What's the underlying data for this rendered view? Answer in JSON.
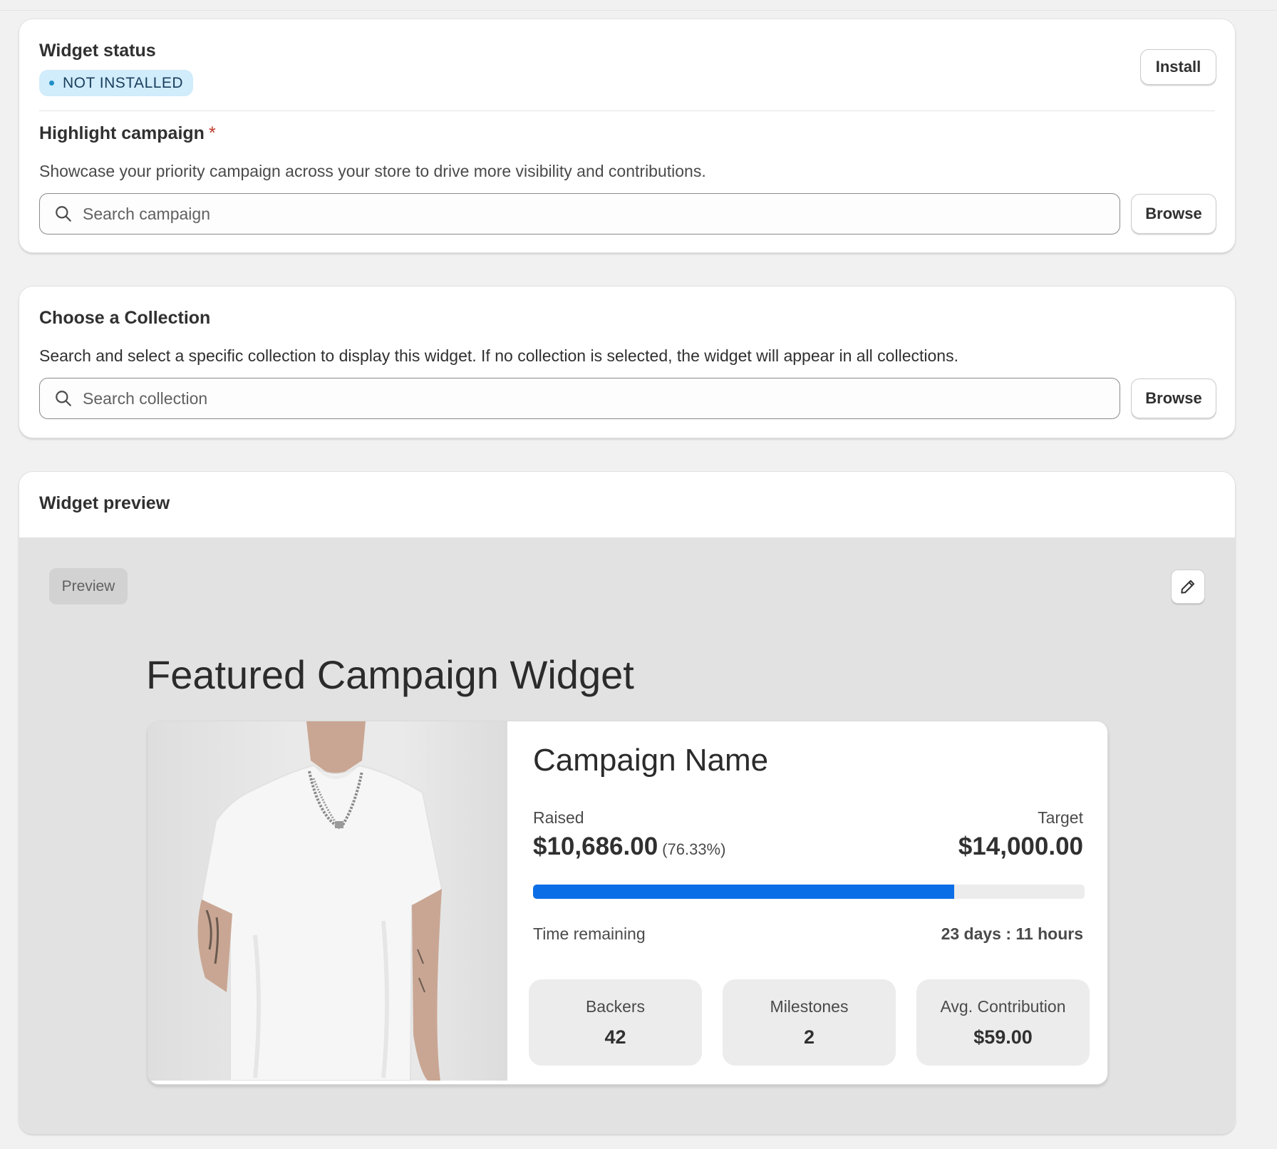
{
  "widget_status": {
    "title": "Widget status",
    "badge": "NOT INSTALLED",
    "install_label": "Install"
  },
  "highlight": {
    "title": "Highlight campaign",
    "required_mark": "*",
    "description": "Showcase your priority campaign across your store to drive more visibility and contributions.",
    "search_placeholder": "Search campaign",
    "search_value": "",
    "browse_label": "Browse"
  },
  "collection": {
    "title": "Choose a Collection",
    "description": "Search and select a specific collection to display this widget. If no collection is selected, the widget will appear in all collections.",
    "search_placeholder": "Search collection",
    "search_value": "",
    "browse_label": "Browse"
  },
  "preview": {
    "title": "Widget preview",
    "pill": "Preview",
    "edit_icon": "pencil-icon",
    "widget_title": "Featured Campaign Widget",
    "campaign_name": "Campaign Name",
    "raised_label": "Raised",
    "raised_value": "$10,686.00",
    "raised_percent": "(76.33%)",
    "progress_fraction": 0.7633,
    "target_label": "Target",
    "target_value": "$14,000.00",
    "time_label": "Time remaining",
    "time_value": "23 days : 11 hours",
    "stats": [
      {
        "label": "Backers",
        "value": "42"
      },
      {
        "label": "Milestones",
        "value": "2"
      },
      {
        "label": "Avg. Contribution",
        "value": "$59.00"
      }
    ]
  },
  "colors": {
    "accent": "#0b6ee6",
    "badge_bg": "#d1ecfb",
    "badge_dot": "#1e8fc6",
    "required": "#c0392b"
  }
}
